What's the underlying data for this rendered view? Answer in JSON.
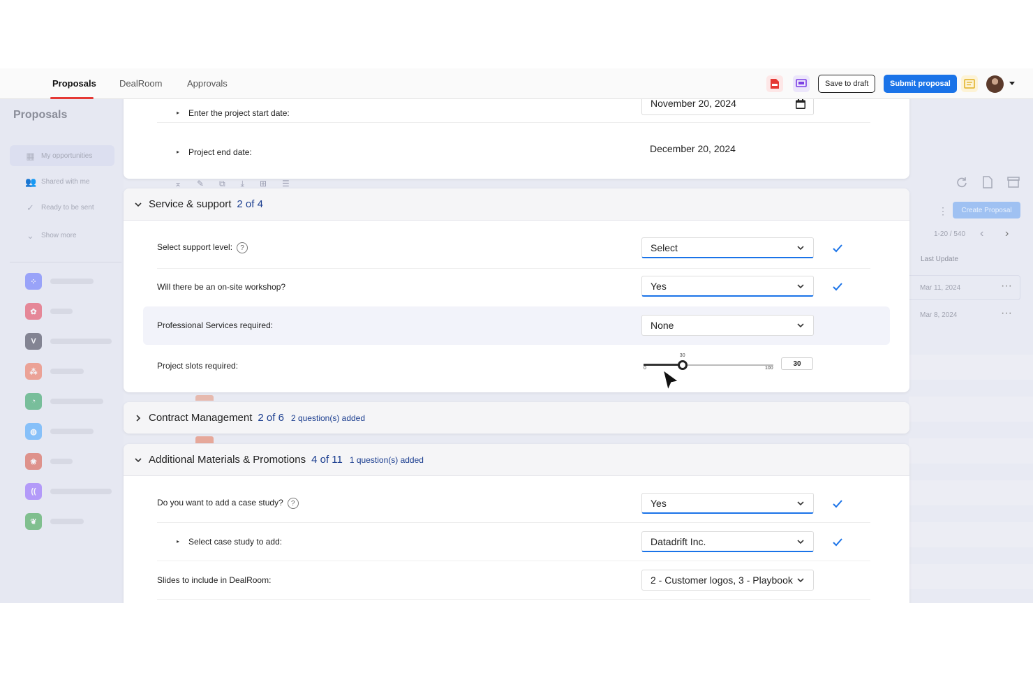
{
  "nav": {
    "tabs": [
      {
        "label": "Proposals",
        "active": true
      },
      {
        "label": "DealRoom",
        "active": false
      },
      {
        "label": "Approvals",
        "active": false
      }
    ],
    "save_draft_label": "Save to draft",
    "submit_label": "Submit proposal",
    "pdf_icon": "pdf-icon",
    "slides_icon": "slides-icon",
    "notes_icon": "note-icon",
    "accent": "#1a73e8",
    "brand_red": "#e53935"
  },
  "sidebar": {
    "title": "Proposals",
    "items": [
      {
        "label": "My opportunities",
        "icon": "grid-icon"
      },
      {
        "label": "Shared with me",
        "icon": "users-icon"
      },
      {
        "label": "Ready to be sent",
        "icon": "check-circle-icon"
      },
      {
        "label": "Show more",
        "icon": "chevron-down-icon"
      }
    ],
    "apps": [
      {
        "letter": "",
        "color": "#5c6bff"
      },
      {
        "letter": "",
        "color": "#e53950"
      },
      {
        "letter": "V",
        "color": "#333347"
      },
      {
        "letter": "",
        "color": "#f06a4e"
      },
      {
        "letter": "",
        "color": "#1f9d55"
      },
      {
        "letter": "",
        "color": "#3aa0ff"
      },
      {
        "letter": "",
        "color": "#d94d3a"
      },
      {
        "letter": "",
        "color": "#8a5cff"
      },
      {
        "letter": "",
        "color": "#2e9e3f"
      }
    ]
  },
  "background_list": {
    "create_label": "Create Proposal",
    "pagination": "1-20 / 540",
    "column_header": "Last Update",
    "rows": [
      {
        "date": "Mar 11, 2024"
      },
      {
        "date": "Mar 8, 2024"
      }
    ]
  },
  "dates_section": {
    "start_label": "Enter the project start date:",
    "start_value": "November 20, 2024",
    "end_label": "Project end date:",
    "end_value": "December 20, 2024"
  },
  "service_section": {
    "title": "Service & support",
    "count": "2 of 4",
    "questions": [
      {
        "label": "Select support level:",
        "value": "Select",
        "answered": true
      },
      {
        "label": "Will there be an on-site workshop?",
        "value": "Yes",
        "answered": true
      },
      {
        "label": "Professional Services required:",
        "value": "None",
        "answered": false
      }
    ],
    "slider": {
      "label": "Project slots required:",
      "min": "0",
      "max": "100",
      "value": "30",
      "value_num": 30
    }
  },
  "contract_section": {
    "title": "Contract Management",
    "count": "2 of 6",
    "added": "2 question(s) added"
  },
  "materials_section": {
    "title": "Additional Materials & Promotions",
    "count": "4 of 11",
    "added": "1 question(s) added",
    "questions": [
      {
        "label": "Do you want to add a case study?",
        "value": "Yes",
        "answered": true
      },
      {
        "label": "Select case study to add:",
        "value": "Datadrift Inc.",
        "answered": true
      },
      {
        "label": "Slides to include in DealRoom:",
        "value": "2 - Customer logos, 3 - Playbook",
        "answered": false
      }
    ]
  }
}
